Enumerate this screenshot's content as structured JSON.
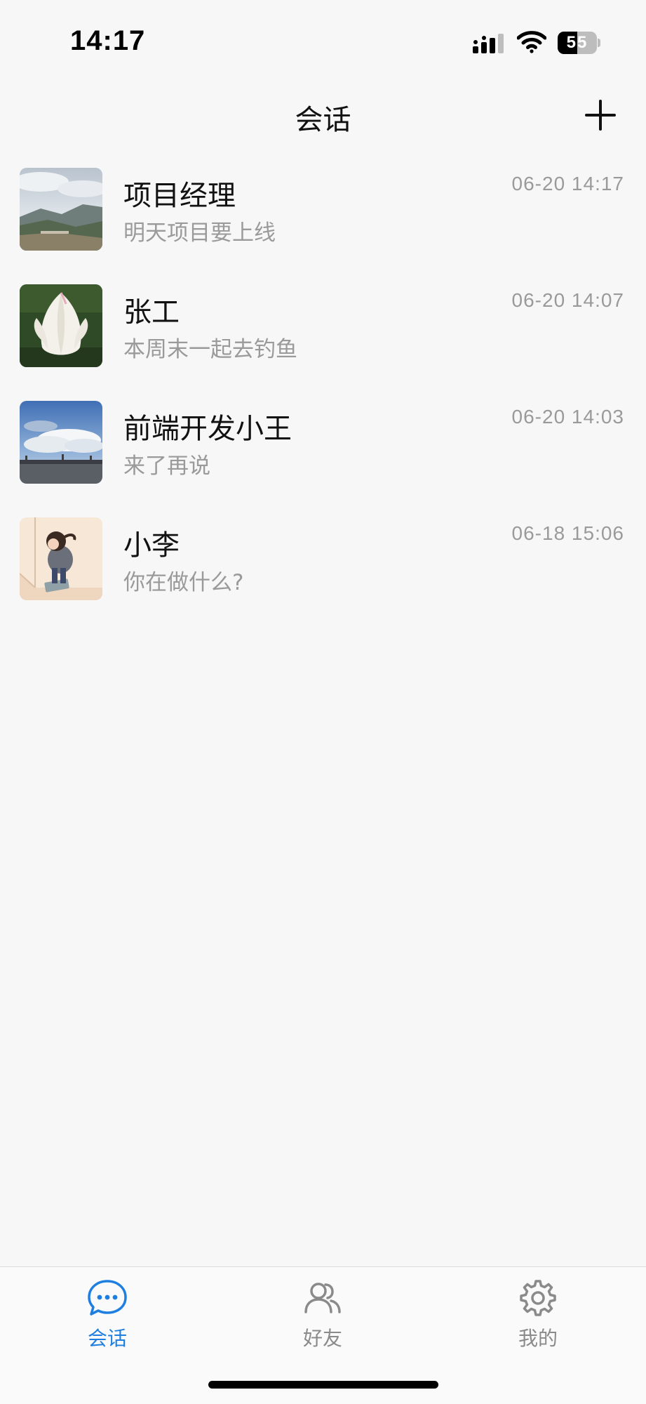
{
  "status_bar": {
    "time": "14:17",
    "battery": "55"
  },
  "nav": {
    "title": "会话"
  },
  "conversations": [
    {
      "name": "项目经理",
      "preview": "明天项目要上线",
      "time": "06-20 14:17"
    },
    {
      "name": "张工",
      "preview": "本周末一起去钓鱼",
      "time": "06-20 14:07"
    },
    {
      "name": "前端开发小王",
      "preview": "来了再说",
      "time": "06-20 14:03"
    },
    {
      "name": "小李",
      "preview": "你在做什么?",
      "time": "06-18 15:06"
    }
  ],
  "tab_bar": {
    "tabs": [
      {
        "label": "会话",
        "icon": "chat-bubble-icon",
        "active": true
      },
      {
        "label": "好友",
        "icon": "friends-icon",
        "active": false
      },
      {
        "label": "我的",
        "icon": "gear-icon",
        "active": false
      }
    ]
  },
  "colors": {
    "accent": "#1e7fe0",
    "background": "#f7f7f7",
    "secondary_text": "#9a9a9a"
  }
}
